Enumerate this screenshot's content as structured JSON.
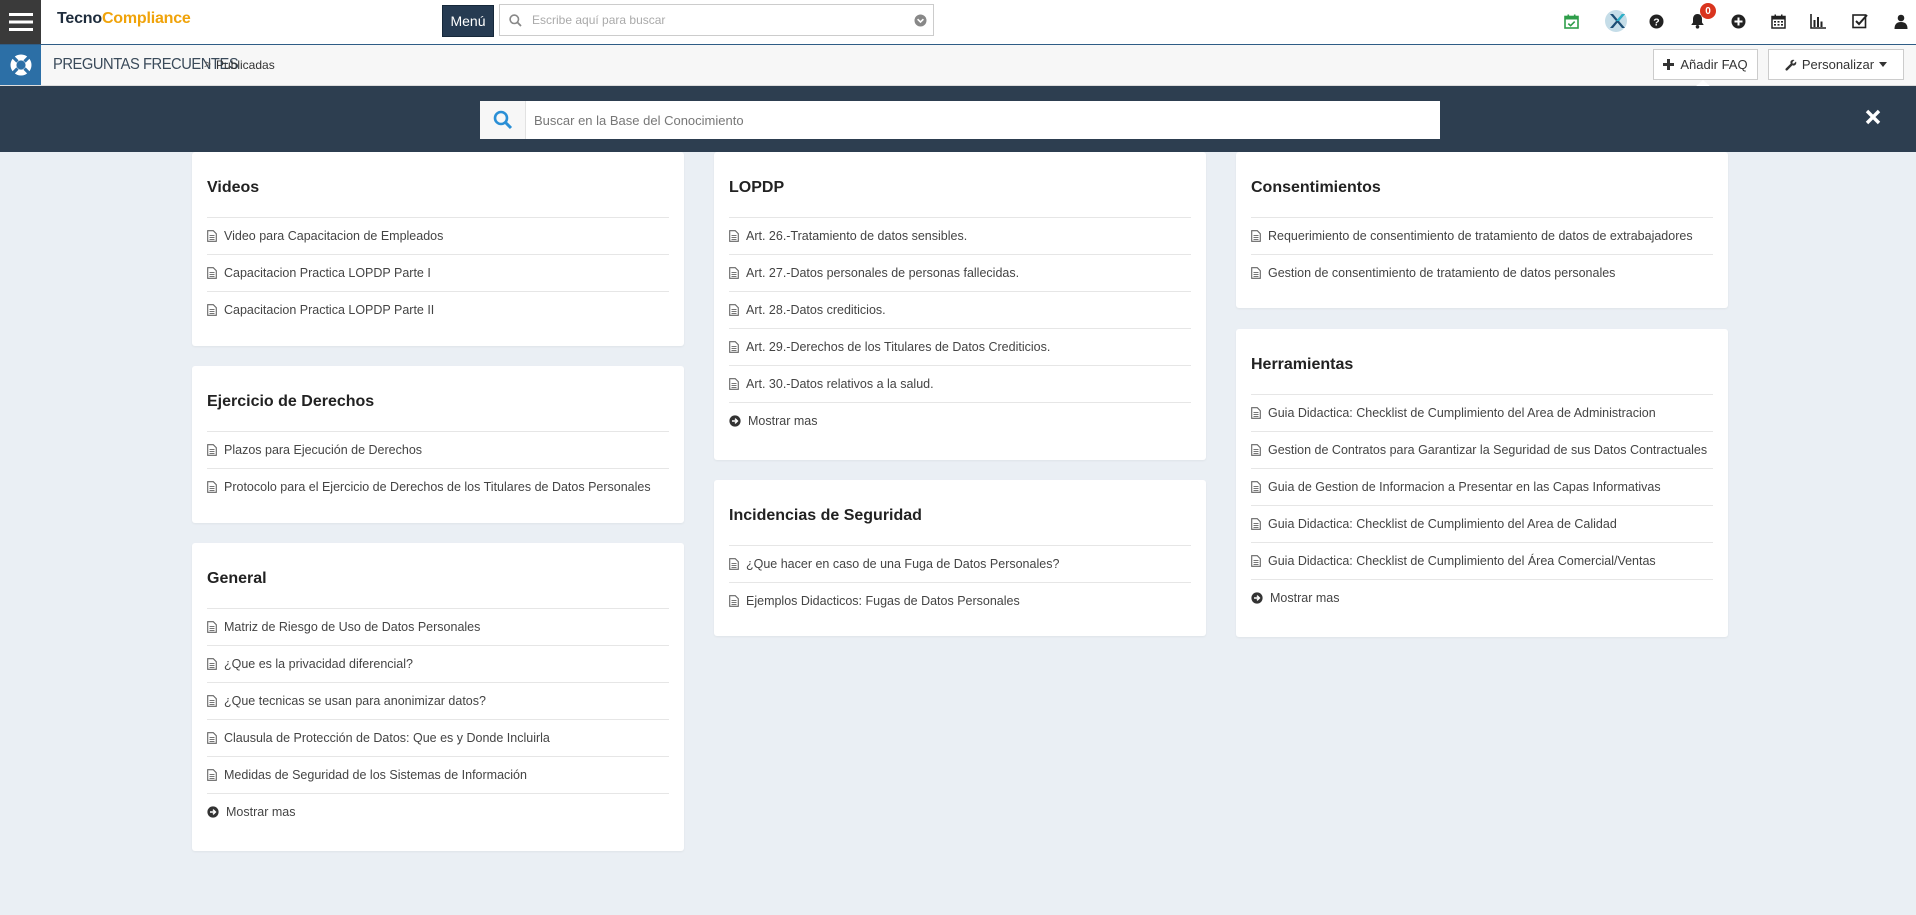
{
  "app": {
    "logo_part1": "Tecno",
    "logo_part2": "Compliance",
    "menu_label": "Menú",
    "search_placeholder": "Escribe aquí para buscar",
    "notifications_count": "0",
    "colors": {
      "accent": "#2d3e50",
      "brand_orange": "#f0a30a",
      "badge": "#d9341e",
      "blue": "#2c6fa6"
    }
  },
  "breadcrumb": {
    "title": "PREGUNTAS FRECUENTES",
    "separator": ">",
    "current": "Publicadas",
    "add_faq_label": "Añadir FAQ",
    "customize_label": "Personalizar"
  },
  "kb": {
    "search_placeholder": "Buscar en la Base del Conocimiento"
  },
  "cards": [
    {
      "title": "Videos",
      "items": [
        "Video para Capacitacion de Empleados",
        "Capacitacion Practica LOPDP Parte I",
        "Capacitacion Practica LOPDP Parte II"
      ]
    },
    {
      "title": "Ejercicio de Derechos",
      "items": [
        "Plazos para Ejecución de Derechos",
        "Protocolo para el Ejercicio de Derechos de los Titulares de Datos Personales"
      ]
    },
    {
      "title": "General",
      "items": [
        "Matriz de Riesgo de Uso de Datos Personales",
        "¿Que es la privacidad diferencial?",
        "¿Que tecnicas se usan para anonimizar datos?",
        "Clausula de Protección de Datos: Que es y Donde Incluirla",
        "Medidas de Seguridad de los Sistemas de Información"
      ],
      "more": "Mostrar mas"
    },
    {
      "title": "LOPDP",
      "items": [
        "Art. 26.-Tratamiento de datos sensibles.",
        "Art. 27.-Datos personales de personas fallecidas.",
        "Art. 28.-Datos crediticios.",
        "Art. 29.-Derechos de los Titulares de Datos Crediticios.",
        "Art. 30.-Datos relativos a la salud."
      ],
      "more": "Mostrar mas"
    },
    {
      "title": "Incidencias de Seguridad",
      "items": [
        "¿Que hacer en caso de una Fuga de Datos Personales?",
        "Ejemplos Didacticos: Fugas de Datos Personales"
      ]
    },
    {
      "title": "Consentimientos",
      "items": [
        "Requerimiento de consentimiento de tratamiento de datos de extrabajadores",
        "Gestion de consentimiento de tratamiento de datos personales"
      ]
    },
    {
      "title": "Herramientas",
      "items": [
        "Guia Didactica: Checklist de Cumplimiento del Area de Administracion",
        "Gestion de Contratos para Garantizar la Seguridad de sus Datos Contractuales",
        "Guia de Gestion de Informacion a Presentar en las Capas Informativas",
        "Guia Didactica: Checklist de Cumplimiento del Area de Calidad",
        "Guia Didactica: Checklist de Cumplimiento del Área Comercial/Ventas"
      ],
      "more": "Mostrar mas"
    }
  ]
}
